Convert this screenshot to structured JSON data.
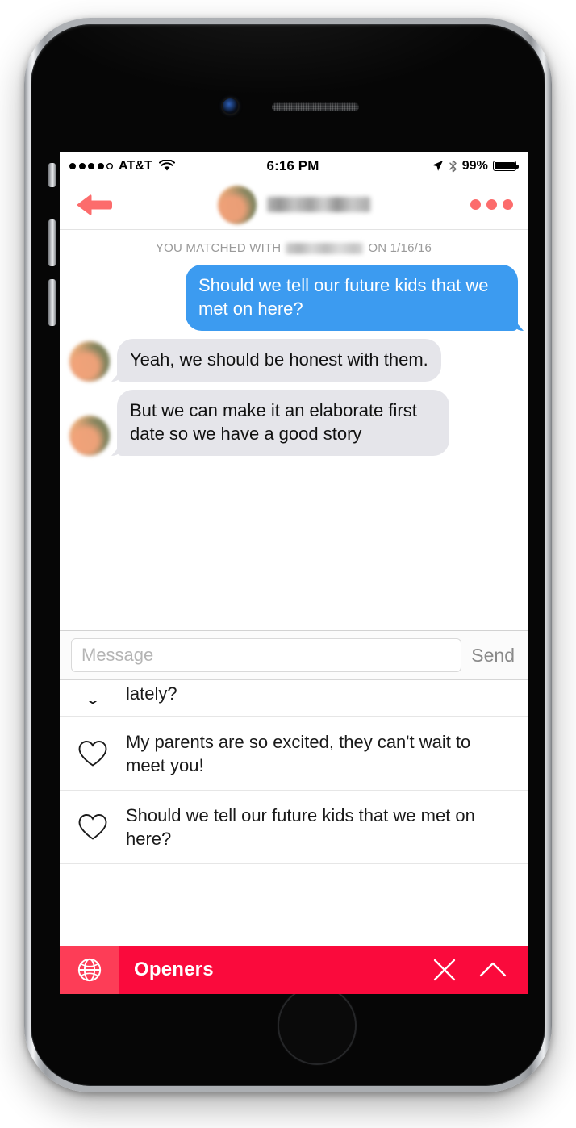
{
  "status_bar": {
    "signal_dots_filled": 4,
    "signal_dots_total": 5,
    "carrier": "AT&T",
    "wifi_icon": "wifi-icon",
    "time": "6:16 PM",
    "location_icon": "location-arrow-icon",
    "bluetooth_icon": "bluetooth-icon",
    "battery_percent": "99%"
  },
  "nav_bar": {
    "back_icon": "back-arrow-icon",
    "match_name": "",
    "avatar": "match-avatar",
    "more_icon": "more-options-icon"
  },
  "chat": {
    "matched_prefix": "YOU MATCHED WITH",
    "matched_name": "",
    "matched_suffix": "ON 1/16/16",
    "messages": [
      {
        "direction": "out",
        "text": "Should we tell our future kids that we met on here?"
      },
      {
        "direction": "in",
        "text": "Yeah, we should be honest with them."
      },
      {
        "direction": "in",
        "text": "But we can make it an elaborate first date so we have a good story"
      }
    ]
  },
  "compose": {
    "placeholder": "Message",
    "value": "",
    "send_label": "Send"
  },
  "openers": {
    "items": [
      {
        "icon": "heart-icon",
        "text": "lately?",
        "clipped": true
      },
      {
        "icon": "heart-icon",
        "text": "My parents are so excited, they can't wait to meet you!",
        "clipped": false
      },
      {
        "icon": "heart-icon",
        "text": "Should we tell our future kids that we met on here?",
        "clipped": false
      }
    ]
  },
  "openers_bar": {
    "globe_icon": "globe-icon",
    "title": "Openers",
    "close_icon": "close-icon",
    "collapse_icon": "chevron-up-icon"
  },
  "colors": {
    "accent_red": "#fa0a3c",
    "accent_red_light": "#fd3d57",
    "coral": "#fc6c6c",
    "bubble_out": "#3c9bf0",
    "bubble_in": "#e5e5ea"
  }
}
